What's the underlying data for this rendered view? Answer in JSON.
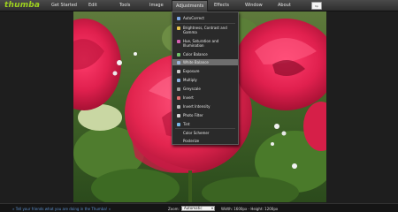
{
  "app": {
    "logo": "thumba",
    "brand_badge": "hp"
  },
  "menu": {
    "items": [
      "Get Started",
      "Edit",
      "Tools",
      "Image",
      "Adjustments",
      "Effects",
      "Window",
      "About"
    ],
    "active": "Adjustments"
  },
  "dropdown": {
    "items": [
      {
        "label": "AutoCorrect",
        "icon": "magic-wand-icon",
        "color": "#7aa7e6"
      },
      {
        "label": "Brightness, Contrast and Gamma",
        "icon": "sun-icon",
        "color": "#e8c24a"
      },
      {
        "label": "Hue, Saturation and Illumination",
        "icon": "color-wheel-icon",
        "color": "#d65fb2"
      },
      {
        "label": "Color Balance",
        "icon": "balance-icon",
        "color": "#6fc06a"
      },
      {
        "label": "White Balance",
        "icon": "white-balance-icon",
        "color": "#9ab5da"
      },
      {
        "label": "Exposure",
        "icon": "exposure-icon",
        "color": "#c9c9c9"
      },
      {
        "label": "Multiply",
        "icon": "multiply-icon",
        "color": "#8fb1e0"
      },
      {
        "label": "Greyscale",
        "icon": "greyscale-icon",
        "color": "#9a9a9a"
      },
      {
        "label": "Invert",
        "icon": "invert-icon",
        "color": "#e07070"
      },
      {
        "label": "Invert Intensity",
        "icon": "invert-intensity-icon",
        "color": "#b9b9b9"
      },
      {
        "label": "Photo Filter",
        "icon": "photo-filter-icon",
        "color": "#d6d6d6"
      },
      {
        "label": "Tint",
        "icon": "tint-icon",
        "color": "#77b7e6"
      },
      {
        "label": "Color Schemer",
        "icon": "color-schemer-icon",
        "color": "#888888"
      },
      {
        "label": "Posterize",
        "icon": "posterize-icon",
        "color": "#888888"
      }
    ],
    "highlighted": "White Balance"
  },
  "status": {
    "tell_friends": "» Tell your friends what you are doing in the Thumba! «",
    "zoom_label": "Zoom:",
    "zoom_value": "Automatic",
    "dimensions": "Width: 1600px - Height: 1200px"
  }
}
